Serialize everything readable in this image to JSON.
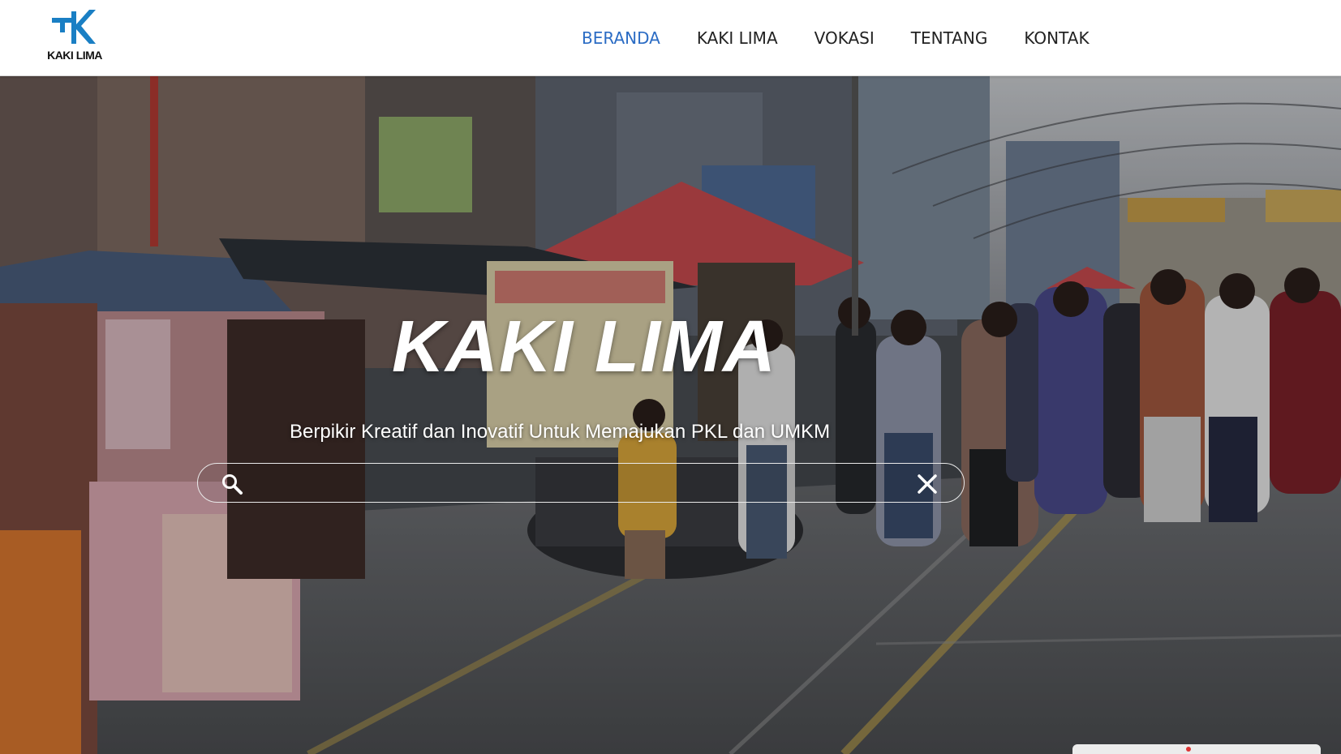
{
  "brand": {
    "logo_text": "KAKI LIMA",
    "logo_color": "#1a7fc4"
  },
  "nav": {
    "items": [
      {
        "label": "BERANDA",
        "active": true
      },
      {
        "label": "KAKI LIMA",
        "active": false
      },
      {
        "label": "VOKASI",
        "active": false
      },
      {
        "label": "TENTANG",
        "active": false
      },
      {
        "label": "KONTAK",
        "active": false
      }
    ],
    "active_color": "#2b6cc4"
  },
  "hero": {
    "title": "KAKI LIMA",
    "subtitle": "Berpikir Kreatif dan Inovatif Untuk Memajukan PKL dan UMKM",
    "search": {
      "value": "",
      "placeholder": "",
      "search_icon": "search-icon",
      "clear_icon": "close-icon"
    }
  }
}
